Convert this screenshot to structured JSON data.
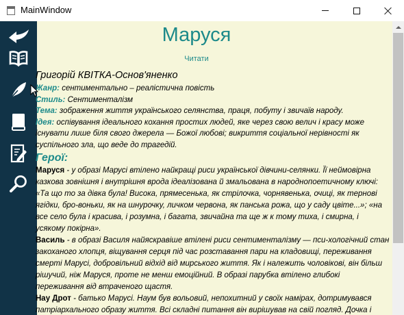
{
  "window": {
    "title": "MainWindow"
  },
  "sidebar": {
    "items": [
      {
        "icon": "back-arrow-icon"
      },
      {
        "icon": "open-book-icon"
      },
      {
        "icon": "feather-quill-icon"
      },
      {
        "icon": "closed-book-icon"
      },
      {
        "icon": "notes-pencil-icon"
      },
      {
        "icon": "search-icon"
      }
    ]
  },
  "colors": {
    "sidebar": "#113347",
    "background": "#f6f6da",
    "accent": "#1d8a8a"
  },
  "page": {
    "title": "Маруся",
    "read_link": "Читати",
    "author": "Григорій КВІТКА-Основ'яненко",
    "genre_label": "Жанр:",
    "genre_value": " сентиментально – реалістична повість",
    "style_label": "Стиль:",
    "style_value": " Сентименталізм",
    "theme_label": "Тема:",
    "theme_value": " зображення життя українського селянства, праця, побуту і звичаїв народу.",
    "idea_label": "Ідея:",
    "idea_value": " оспівування ідеального кохання простих людей, яке через свою велич і красу може існувати лише біля свого джерела — Божої любові; викриття соціальної нерівності як суспільного зла, що веде до трагедій.",
    "heroes_heading": "Герої:",
    "heroes": [
      {
        "name": "Маруся",
        "text": " - у образі  Марусі втілено найкращі риси української дівчини-селянки. Її неймовірна казкова зовнішня і внутрішня врода ідеалізована й змальована в народнопоетичному ключі: «Та що то за дівка була! Висока, прямесенька, як стрілочка, чорнявенька, очиці, як тернові ягідки, бро-воньки, як на шнурочку, личком червона, як панська рожа, що у саду цвіте...»; «на все село була і красива, і розумна, і багата, звичайна та ще ж к тому тиха, і смирна, і усякому покірна»."
      },
      {
        "name": "Василь",
        "text": " - в образі Василя найяскравіше втілені риси сентименталізму — пси-хологічний стан закоханого хлопця, віщування серця під час розставання пари на кладовищі, переживання смерті Марусі, добровільний відхід від мирського життя. Як і належить чоловікові, він більш рішучий, ніж Маруся, проте не менш емоційний. В образі парубка втілено глибокі переживання від втраченого щастя."
      },
      {
        "name": "Нау Дрот",
        "text": " - батько Марусі. Наум був вольовий, непохитний у своїх намірах, дотримувався патріархального образу життя. Всі складні питання він вирішував на свій погляд. Дочка і дружина безперечно слухали його."
      }
    ]
  }
}
